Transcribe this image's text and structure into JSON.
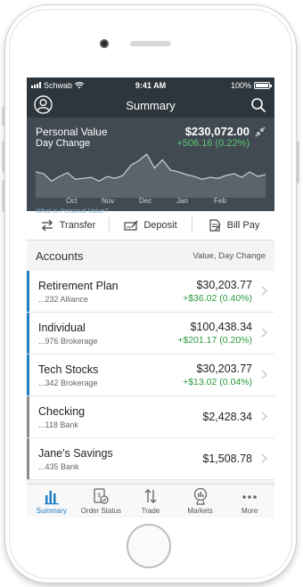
{
  "status_bar": {
    "carrier": "Schwab",
    "time": "9:41 AM",
    "battery": "100%"
  },
  "nav": {
    "title": "Summary"
  },
  "hero": {
    "personal_value_label": "Personal Value",
    "personal_value": "$230,072.00",
    "day_change_label": "Day Change",
    "day_change": "+506.16 (0.22%)",
    "months": [
      "Oct",
      "Nov",
      "Dec",
      "Jan",
      "Feb"
    ],
    "link": "What is Personal Value?"
  },
  "chart_data": {
    "type": "area",
    "x": [
      "Oct",
      "Nov",
      "Dec",
      "Jan",
      "Feb"
    ],
    "title": "",
    "xlabel": "",
    "ylabel": "",
    "series": [
      {
        "values": [
          28,
          26,
          18,
          23,
          27,
          20,
          21,
          22,
          18,
          23,
          21,
          24,
          35,
          40,
          47,
          32,
          41,
          30,
          28,
          25,
          23,
          20,
          22,
          21,
          24,
          26,
          22,
          28,
          23,
          25
        ]
      }
    ],
    "grid": false,
    "colors": {
      "line": "#c9d0d6",
      "fill": "#5a646c"
    }
  },
  "actions": [
    {
      "label": "Transfer",
      "icon": "transfer-icon"
    },
    {
      "label": "Deposit",
      "icon": "deposit-icon"
    },
    {
      "label": "Bill Pay",
      "icon": "bill-pay-icon"
    }
  ],
  "accounts_header": {
    "title": "Accounts",
    "subtitle": "Value, Day Change"
  },
  "accounts": [
    {
      "name": "Retirement Plan",
      "sub": "...232 Alliance",
      "value": "$30,203.77",
      "change": "+$36.02 (0.40%)",
      "color": "#1f7dc2"
    },
    {
      "name": "Individual",
      "sub": "...976 Brokerage",
      "value": "$100,438.34",
      "change": "+$201.17 (0.20%)",
      "color": "#1f7dc2"
    },
    {
      "name": "Tech Stocks",
      "sub": "...342 Brokerage",
      "value": "$30,203.77",
      "change": "+$13.02 (0.04%)",
      "color": "#1f7dc2"
    },
    {
      "name": "Checking",
      "sub": "...118 Bank",
      "value": "$2,428.34",
      "change": "",
      "color": "#8b8b8b"
    },
    {
      "name": "Jane's Savings",
      "sub": "...435 Bank",
      "value": "$1,508.78",
      "change": "",
      "color": "#8b8b8b"
    }
  ],
  "tabs": [
    {
      "label": "Summary",
      "icon": "summary-icon",
      "active": true
    },
    {
      "label": "Order Status",
      "icon": "order-status-icon"
    },
    {
      "label": "Trade",
      "icon": "trade-icon"
    },
    {
      "label": "Markets",
      "icon": "markets-icon"
    },
    {
      "label": "More",
      "icon": "more-icon"
    }
  ]
}
